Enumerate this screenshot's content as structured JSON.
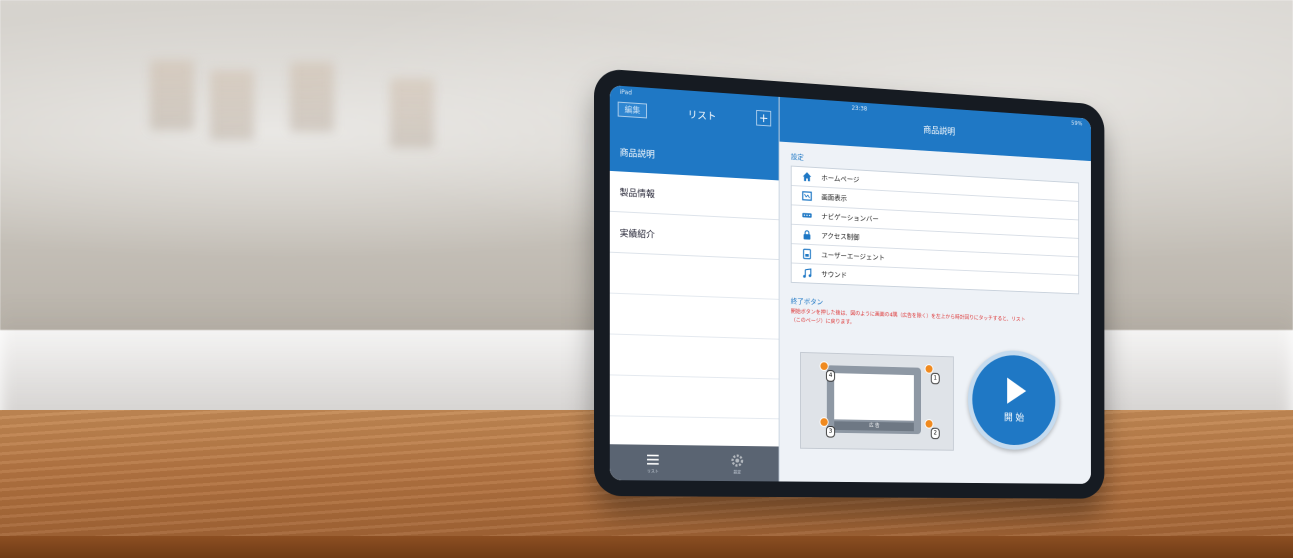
{
  "status_bar": {
    "left": "iPad",
    "time": "23:38",
    "battery": "59%"
  },
  "left_panel": {
    "edit_label": "編集",
    "title": "リスト",
    "add_label": "+",
    "items": [
      {
        "label": "商品説明",
        "active": true
      },
      {
        "label": "製品情報",
        "active": false
      },
      {
        "label": "実績紹介",
        "active": false
      }
    ],
    "tabs": [
      {
        "icon": "list-icon",
        "label": "リスト"
      },
      {
        "icon": "gear-icon",
        "label": "設定"
      }
    ]
  },
  "right_panel": {
    "title": "商品説明",
    "settings_header": "設定",
    "settings": [
      {
        "icon": "home-icon",
        "label": "ホームページ"
      },
      {
        "icon": "screen-icon",
        "label": "画面表示"
      },
      {
        "icon": "navbar-icon",
        "label": "ナビゲーションバー"
      },
      {
        "icon": "lock-icon",
        "label": "アクセス制御"
      },
      {
        "icon": "user-agent-icon",
        "label": "ユーザーエージェント"
      },
      {
        "icon": "music-icon",
        "label": "サウンド"
      }
    ],
    "end_button_header": "終了ボタン",
    "end_button_text_line1": "開始ボタンを押した後は、図のように画面の4隅（広告を除く）を左上から時計回りにタッチすると、リスト",
    "end_button_text_line2": "（このページ）に戻ります。",
    "diagram": {
      "ad_label": "広 告",
      "corners": [
        "1",
        "2",
        "3",
        "4"
      ]
    },
    "start_label": "開 始"
  },
  "colors": {
    "accent": "#1f78c5",
    "warning_text": "#dd3333",
    "corner_marker": "#f08a1f"
  }
}
